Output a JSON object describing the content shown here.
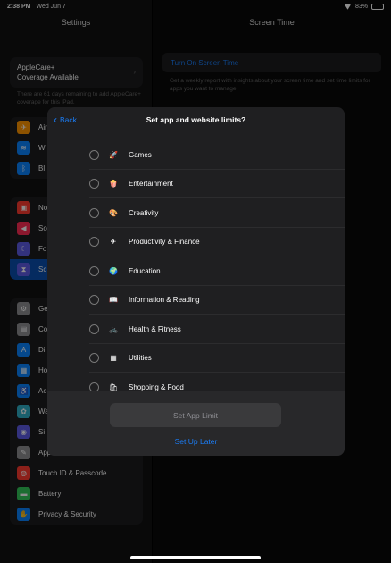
{
  "status_bar": {
    "time": "2:38 PM",
    "date": "Wed Jun 7",
    "battery": "83%"
  },
  "settings": {
    "title": "Settings",
    "applecare": {
      "line1": "AppleCare+",
      "line2": "Coverage Available"
    },
    "applecare_note": "There are 61 days remaining to add AppleCare+ coverage for this iPad.",
    "group1": [
      {
        "label": "Air",
        "color": "#ff9500",
        "glyph": "✈"
      },
      {
        "label": "Wi",
        "color": "#0a84ff",
        "glyph": "≋"
      },
      {
        "label": "Bl",
        "color": "#0a84ff",
        "glyph": "ᛒ"
      }
    ],
    "group2": [
      {
        "label": "No",
        "color": "#ff3b30",
        "glyph": "▣"
      },
      {
        "label": "So",
        "color": "#ff2d55",
        "glyph": "◀"
      },
      {
        "label": "Fo",
        "color": "#5e5ce6",
        "glyph": "☾"
      },
      {
        "label": "Sc",
        "color": "#5e5ce6",
        "glyph": "⧗"
      }
    ],
    "group3": [
      {
        "label": "Ge",
        "color": "#8e8e93",
        "glyph": "⚙"
      },
      {
        "label": "Co",
        "color": "#8e8e93",
        "glyph": "▤"
      },
      {
        "label": "Di",
        "color": "#0a84ff",
        "glyph": "A"
      },
      {
        "label": "Ho",
        "color": "#0a84ff",
        "glyph": "▦"
      },
      {
        "label": "Ac",
        "color": "#0a84ff",
        "glyph": "♿"
      },
      {
        "label": "Wa",
        "color": "#30b0c7",
        "glyph": "✿"
      },
      {
        "label": "Si",
        "color": "#5e5ce6",
        "glyph": "◉"
      },
      {
        "label": "Apple Pencil",
        "color": "#8e8e93",
        "glyph": "✎"
      },
      {
        "label": "Touch ID & Passcode",
        "color": "#ff3b30",
        "glyph": "◍"
      },
      {
        "label": "Battery",
        "color": "#34c759",
        "glyph": "▬"
      },
      {
        "label": "Privacy & Security",
        "color": "#0a84ff",
        "glyph": "✋"
      }
    ]
  },
  "screen_time": {
    "title": "Screen Time",
    "turn_on": "Turn On Screen Time",
    "note": "Get a weekly report with insights about your screen time and set time limits for apps you want to manage"
  },
  "modal": {
    "back": "Back",
    "title": "Set app and website limits?",
    "categories": [
      {
        "label": "Games",
        "icon": "rocket-icon",
        "glyph": "🚀"
      },
      {
        "label": "Entertainment",
        "icon": "popcorn-icon",
        "glyph": "🍿"
      },
      {
        "label": "Creativity",
        "icon": "palette-icon",
        "glyph": "🎨"
      },
      {
        "label": "Productivity & Finance",
        "icon": "paper-plane-icon",
        "glyph": "✈"
      },
      {
        "label": "Education",
        "icon": "globe-icon",
        "glyph": "🌍"
      },
      {
        "label": "Information & Reading",
        "icon": "book-icon",
        "glyph": "📖"
      },
      {
        "label": "Health & Fitness",
        "icon": "bicycle-icon",
        "glyph": "🚲"
      },
      {
        "label": "Utilities",
        "icon": "calculator-icon",
        "glyph": "▦"
      },
      {
        "label": "Shopping & Food",
        "icon": "shopping-icon",
        "glyph": "🛍"
      }
    ],
    "set_limit": "Set App Limit",
    "later": "Set Up Later"
  }
}
